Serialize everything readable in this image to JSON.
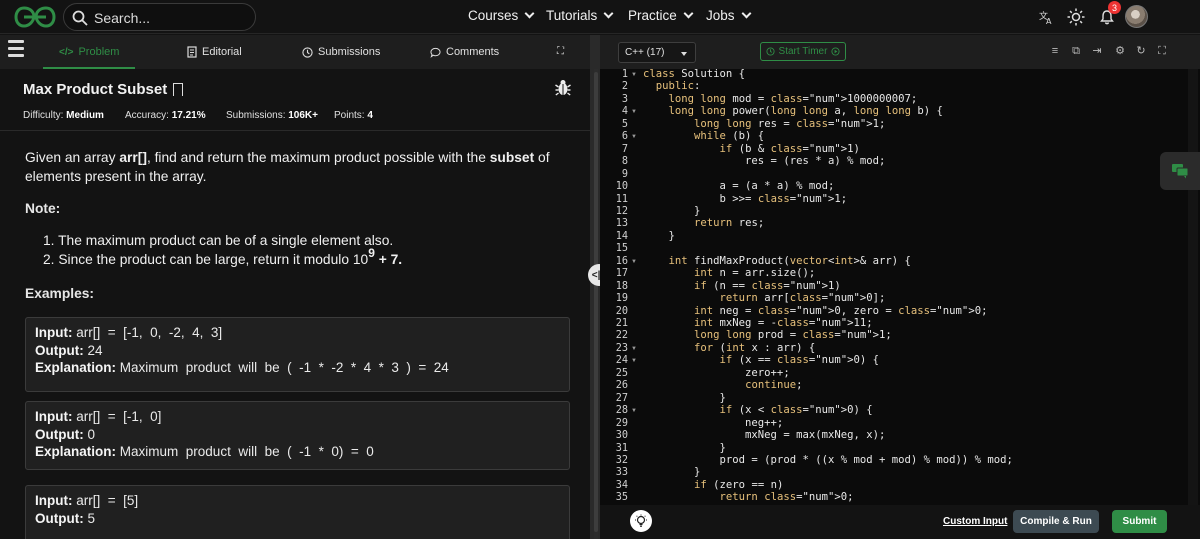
{
  "header": {
    "search_placeholder": "Search...",
    "nav": [
      {
        "label": "Courses"
      },
      {
        "label": "Tutorials"
      },
      {
        "label": "Practice"
      },
      {
        "label": "Jobs"
      }
    ],
    "notification_count": "3"
  },
  "left_tabs": {
    "problem": "Problem",
    "editorial": "Editorial",
    "submissions": "Submissions",
    "comments": "Comments"
  },
  "problem": {
    "title": "Max Product Subset",
    "difficulty_label": "Difficulty:",
    "difficulty": "Medium",
    "accuracy_label": "Accuracy:",
    "accuracy": "17.21%",
    "submissions_label": "Submissions:",
    "submissions": "106K+",
    "points_label": "Points:",
    "points": "4",
    "desc_part1": "Given an array ",
    "desc_arr": "arr[]",
    "desc_part2": ", find and return the maximum product possible with the ",
    "desc_subset": "subset",
    "desc_part3": " of elements present in the array.",
    "note_label": "Note:",
    "notes": [
      "1. The maximum product can be of a single element also.",
      "2. Since the product can be large, return it modulo 10"
    ],
    "note2_sup": "9",
    "note2_tail": " + 7.",
    "examples_label": "Examples:",
    "examples": [
      {
        "input": "arr[]  =  [-1,  0,  -2,  4,  3]",
        "output": "24",
        "explanation": "Maximum  product  will  be  (  -1  *  -2  *  4  *  3  )  =  24"
      },
      {
        "input": "arr[]  =  [-1,  0]",
        "output": "0",
        "explanation": "Maximum  product  will  be  (  -1  *  0)  =  0"
      },
      {
        "input": "arr[]  =  [5]",
        "output": "5",
        "explanation": ""
      }
    ],
    "input_label": "Input:",
    "output_label": "Output:",
    "explanation_label": "Explanation:"
  },
  "editor": {
    "language": "C++ (17)",
    "timer_label": "Start Timer",
    "custom_input": "Custom Input",
    "compile_run": "Compile & Run",
    "submit": "Submit",
    "code_lines": [
      "class Solution {",
      "  public:",
      "    long long mod = 1000000007;",
      "    long long power(long long a, long long b) {",
      "        long long res = 1;",
      "        while (b) {",
      "            if (b & 1)",
      "                res = (res * a) % mod;",
      "",
      "            a = (a * a) % mod;",
      "            b >>= 1;",
      "        }",
      "        return res;",
      "    }",
      "",
      "    int findMaxProduct(vector<int>& arr) {",
      "        int n = arr.size();",
      "        if (n == 1)",
      "            return arr[0];",
      "        int neg = 0, zero = 0;",
      "        int mxNeg = -11;",
      "        long long prod = 1;",
      "        for (int x : arr) {",
      "            if (x == 0) {",
      "                zero++;",
      "                continue;",
      "            }",
      "            if (x < 0) {",
      "                neg++;",
      "                mxNeg = max(mxNeg, x);",
      "            }",
      "            prod = (prod * ((x % mod + mod) % mod)) % mod;",
      "        }",
      "        if (zero == n)",
      "            return 0;"
    ]
  }
}
